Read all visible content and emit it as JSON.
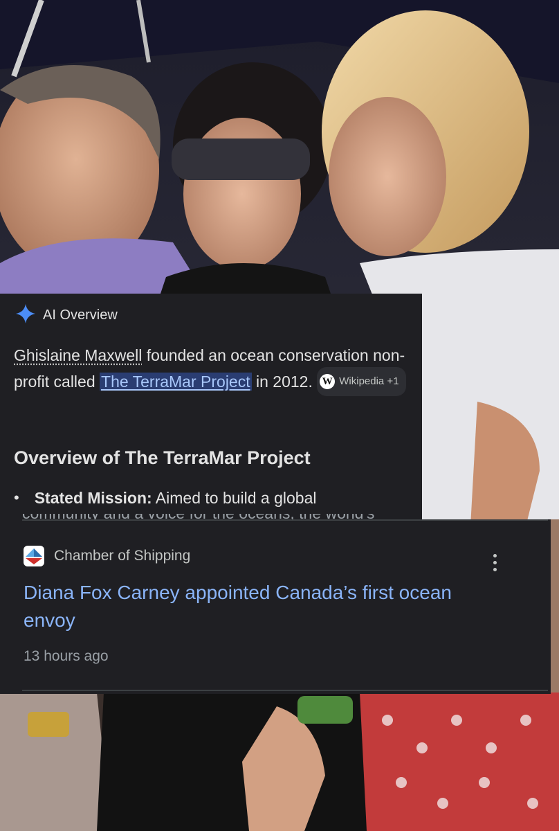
{
  "ai_overview": {
    "header_label": "AI Overview",
    "entity_link": "Ghislaine Maxwell",
    "text_1": " founded an ocean conservation non-profit called ",
    "highlight_link": "The TerraMar Project",
    "text_2": " in 2012. ",
    "source_chip": "Wikipedia +1",
    "source_chip_icon": "W",
    "section_heading": "Overview of The TerraMar Project",
    "bullet_label": "Stated Mission:",
    "bullet_text": " Aimed to build a global",
    "bullet_cutoff": "community and a voice for the oceans, the world's"
  },
  "news": {
    "source": "Chamber of Shipping",
    "title": "Diana Fox Carney appointed Canada’s first ocean envoy",
    "time": "13 hours ago"
  },
  "colors": {
    "card_bg": "#1f1f23",
    "link_blue": "#8ab4f8",
    "highlight_bg": "#2a3d72",
    "gemini_blue": "#4c8df6"
  }
}
